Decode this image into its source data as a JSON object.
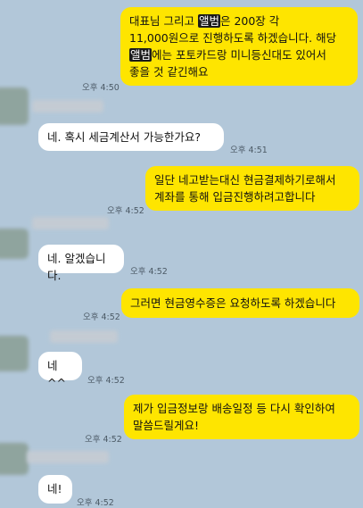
{
  "messages": [
    {
      "text_parts": [
        "대표님 그리고 ",
        "앨범",
        "은 200장 각",
        "11,000원으로 진행하도록 하겠습니다. 해당",
        "앨범",
        "에는 포토카드랑 미니등신대도 있어서",
        "좋을 것 같긴해요"
      ],
      "time": "오후 4:50"
    },
    {
      "text": "네. 혹시 세금계산서 가능한가요?",
      "time": "오후 4:51"
    },
    {
      "lines": [
        "일단 네고받는대신 현금결제하기로해서",
        "계좌를 통해 입금진행하려고합니다"
      ],
      "time": "오후 4:52"
    },
    {
      "text": "네. 알겠습니다.",
      "time": "오후 4:52"
    },
    {
      "text": "그러면 현금영수증은 요청하도록 하겠습니다",
      "time": "오후 4:52"
    },
    {
      "text": "네 ^^",
      "time": "오후 4:52"
    },
    {
      "lines": [
        "제가 입금정보랑 배송일정 등 다시 확인하여",
        "말씀드릴게요!"
      ],
      "time": "오후 4:52"
    },
    {
      "text": "네!",
      "time": "오후 4:52"
    }
  ],
  "colors": {
    "background": "#b2c7d9",
    "my_bubble": "#fee500",
    "their_bubble": "#ffffff"
  }
}
